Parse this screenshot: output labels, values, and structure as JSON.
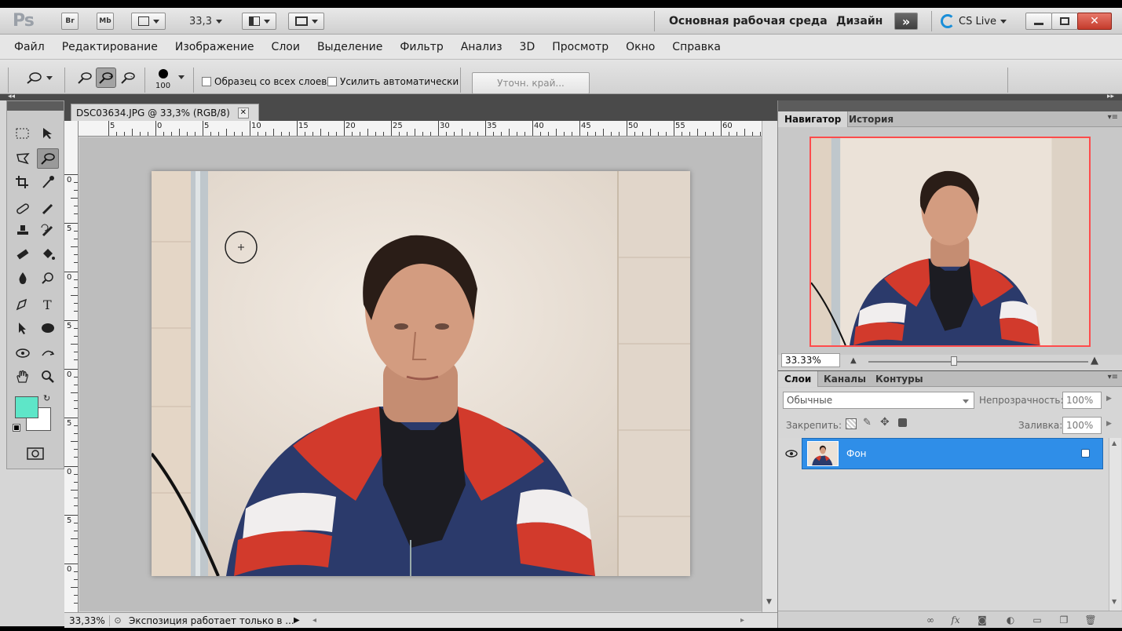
{
  "appbar": {
    "logo": "Ps",
    "bridge": "Br",
    "minibridge": "Mb",
    "zoom": "33,3",
    "workspace_basic": "Основная рабочая среда",
    "workspace_design": "Дизайн",
    "cslive": "CS Live"
  },
  "menu": [
    "Файл",
    "Редактирование",
    "Изображение",
    "Слои",
    "Выделение",
    "Фильтр",
    "Анализ",
    "3D",
    "Просмотр",
    "Окно",
    "Справка"
  ],
  "options": {
    "brush_size": "100",
    "sample_all": "Образец со всех слоев",
    "auto_enhance": "Усилить автоматически",
    "refine_edge": "Уточн. край..."
  },
  "document": {
    "tab_title": "DSC03634.JPG @ 33,3% (RGB/8)",
    "close": "✕",
    "ruler_h": [
      "5",
      "0",
      "5",
      "10",
      "15",
      "20",
      "25",
      "30",
      "35",
      "40",
      "45",
      "50",
      "55",
      "60"
    ],
    "ruler_v": [
      "0",
      "5",
      "0",
      "5",
      "0",
      "5",
      "0",
      "5",
      "0",
      "5"
    ]
  },
  "status": {
    "zoom": "33,33%",
    "message": "Экспозиция работает только в ..."
  },
  "navigator": {
    "tab_active": "Навигатор",
    "tab_other": "История",
    "zoom": "33.33%"
  },
  "layers_panel": {
    "tabs": [
      "Слои",
      "Каналы",
      "Контуры"
    ],
    "blend_mode": "Обычные",
    "opacity_label": "Непрозрачность:",
    "opacity_value": "100%",
    "lock_label": "Закрепить:",
    "fill_label": "Заливка:",
    "fill_value": "100%",
    "layer_name": "Фон"
  },
  "colors": {
    "foreground": "#5ee6c8",
    "background": "#ffffff",
    "selection": "#2f8ee8",
    "navigator_frame": "#ff4c4c"
  }
}
